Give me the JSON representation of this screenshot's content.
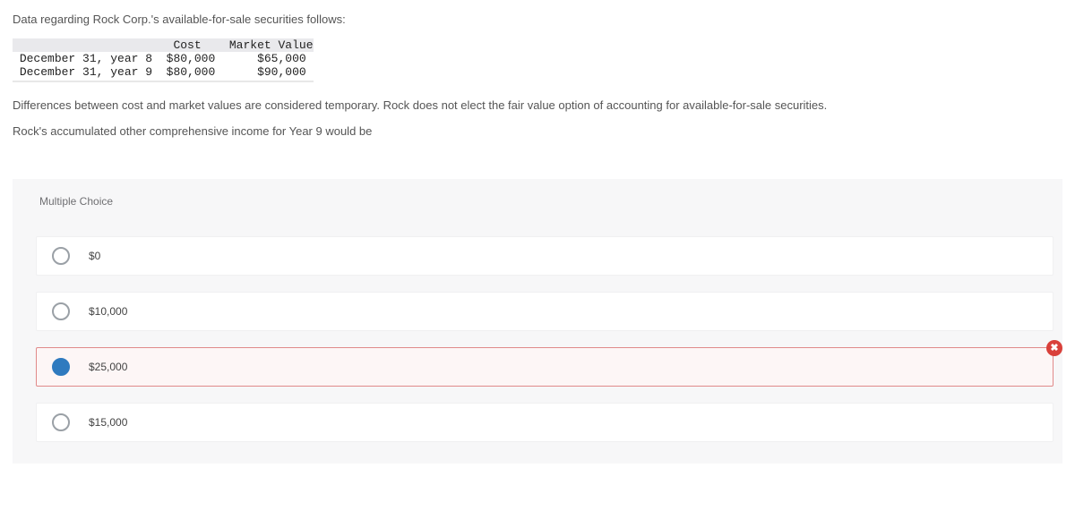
{
  "intro": "Data regarding Rock Corp.'s available-for-sale securities follows:",
  "table": {
    "header": {
      "label_col": "",
      "cost": "Cost",
      "market": "Market Value"
    },
    "rows": [
      {
        "label": "December 31, year 8",
        "cost": "$80,000",
        "market": "$65,000"
      },
      {
        "label": "December 31, year 9",
        "cost": "$80,000",
        "market": "$90,000"
      }
    ]
  },
  "para1": "Differences between cost and market values are considered temporary. Rock does not elect the fair value option of accounting for available-for-sale securities.",
  "para2": "Rock's accumulated other comprehensive income for Year 9 would be",
  "mc_label": "Multiple Choice",
  "options": [
    {
      "label": "$0",
      "selected": false,
      "wrong": false
    },
    {
      "label": "$10,000",
      "selected": false,
      "wrong": false
    },
    {
      "label": "$25,000",
      "selected": true,
      "wrong": true
    },
    {
      "label": "$15,000",
      "selected": false,
      "wrong": false
    }
  ],
  "wrong_badge": "✖"
}
